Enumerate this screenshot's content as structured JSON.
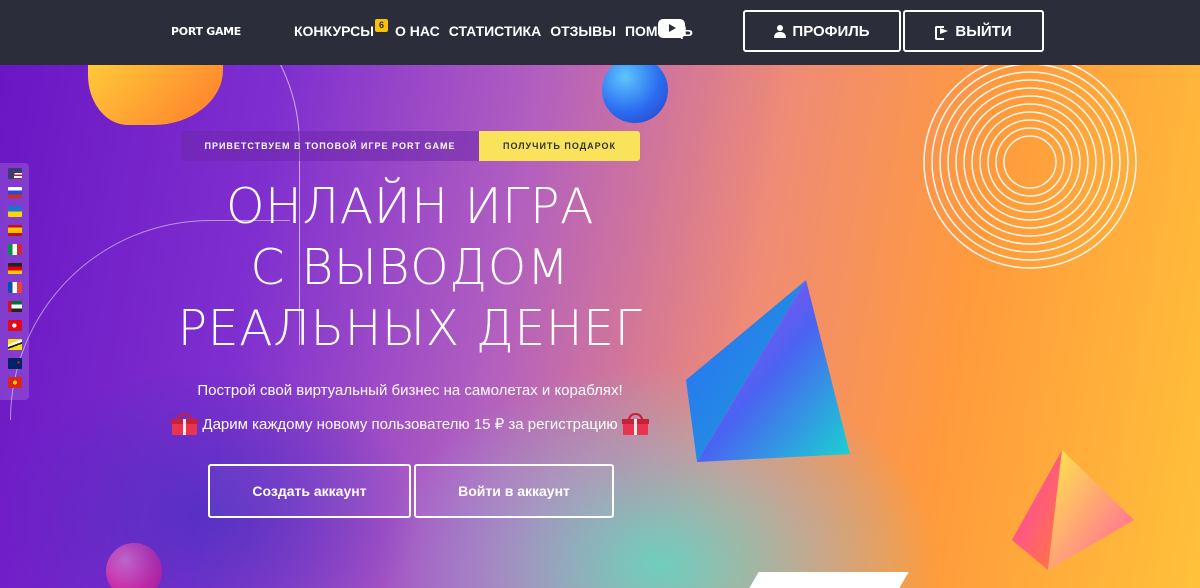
{
  "logo": "PORT GAME",
  "nav": {
    "items": [
      {
        "label": "КОНКУРСЫ",
        "badge": "6"
      },
      {
        "label": "О НАС"
      },
      {
        "label": "СТАТИСТИКА"
      },
      {
        "label": "ОТЗЫВЫ"
      },
      {
        "label": "ПОМОЩЬ"
      }
    ],
    "youtube_icon": "youtube-icon"
  },
  "header_buttons": {
    "profile": "ПРОФИЛЬ",
    "logout": "ВЫЙТИ"
  },
  "hero": {
    "welcome": "ПРИВЕТСТВУЕМ В ТОПОВОЙ ИГРЕ PORT GAME",
    "gift_button": "ПОЛУЧИТЬ ПОДАРОК",
    "headline": [
      "ОНЛАЙН ИГРА",
      "С ВЫВОДОМ",
      "РЕАЛЬНЫХ ДЕНЕГ"
    ],
    "subtitle": "Построй свой виртуальный бизнес на самолетах и кораблях!",
    "bonus": "Дарим каждому новому пользователю 15 ₽ за регистрацию",
    "create_button": "Создать аккаунт",
    "login_button": "Войти в аккаунт"
  },
  "languages": [
    "us",
    "ru",
    "ua",
    "es",
    "it",
    "de",
    "fr",
    "ae",
    "tr",
    "bn",
    "nz",
    "vn"
  ],
  "colors": {
    "navbar": "#2b2d3a",
    "gift_button": "#f8e35a",
    "accent_badge": "#f6c10a"
  }
}
